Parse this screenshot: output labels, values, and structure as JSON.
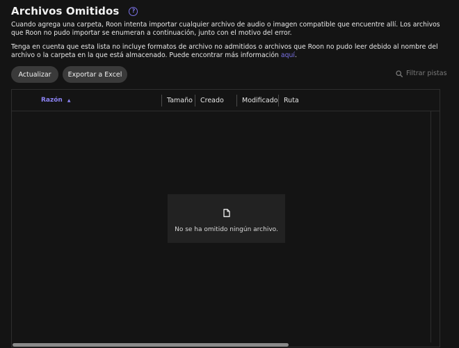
{
  "header": {
    "title": "Archivos Omitidos",
    "help_icon": "question-circle-icon"
  },
  "description": {
    "paragraph1": "Cuando agrega una carpeta, Roon intenta importar cualquier archivo de audio o imagen compatible que encuentre allí. Los archivos que Roon no pudo importar se enumeran a continuación, junto con el motivo del error.",
    "paragraph2_text": "Tenga en cuenta que esta lista no incluye formatos de archivo no admitidos o archivos que Roon no pudo leer debido al nombre del archivo o la carpeta en la que está almacenado. Puede encontrar más información ",
    "paragraph2_link": "aquí",
    "paragraph2_end": "."
  },
  "toolbar": {
    "refresh_label": "Actualizar",
    "export_label": "Exportar a Excel",
    "filter_placeholder": "Filtrar pistas",
    "filter_icon": "search-icon"
  },
  "table": {
    "columns": {
      "reason": "Razón",
      "size": "Tamaño",
      "created": "Creado",
      "modified": "Modificado",
      "path": "Ruta"
    },
    "sort_indicator": "▲",
    "sorted_column": "reason",
    "rows": [],
    "empty_icon": "file-icon",
    "empty_message": "No se ha omitido ningún archivo."
  },
  "colors": {
    "background": "#141414",
    "accent": "#7b72e6",
    "button": "#3a3a3a",
    "panel": "#222222"
  }
}
